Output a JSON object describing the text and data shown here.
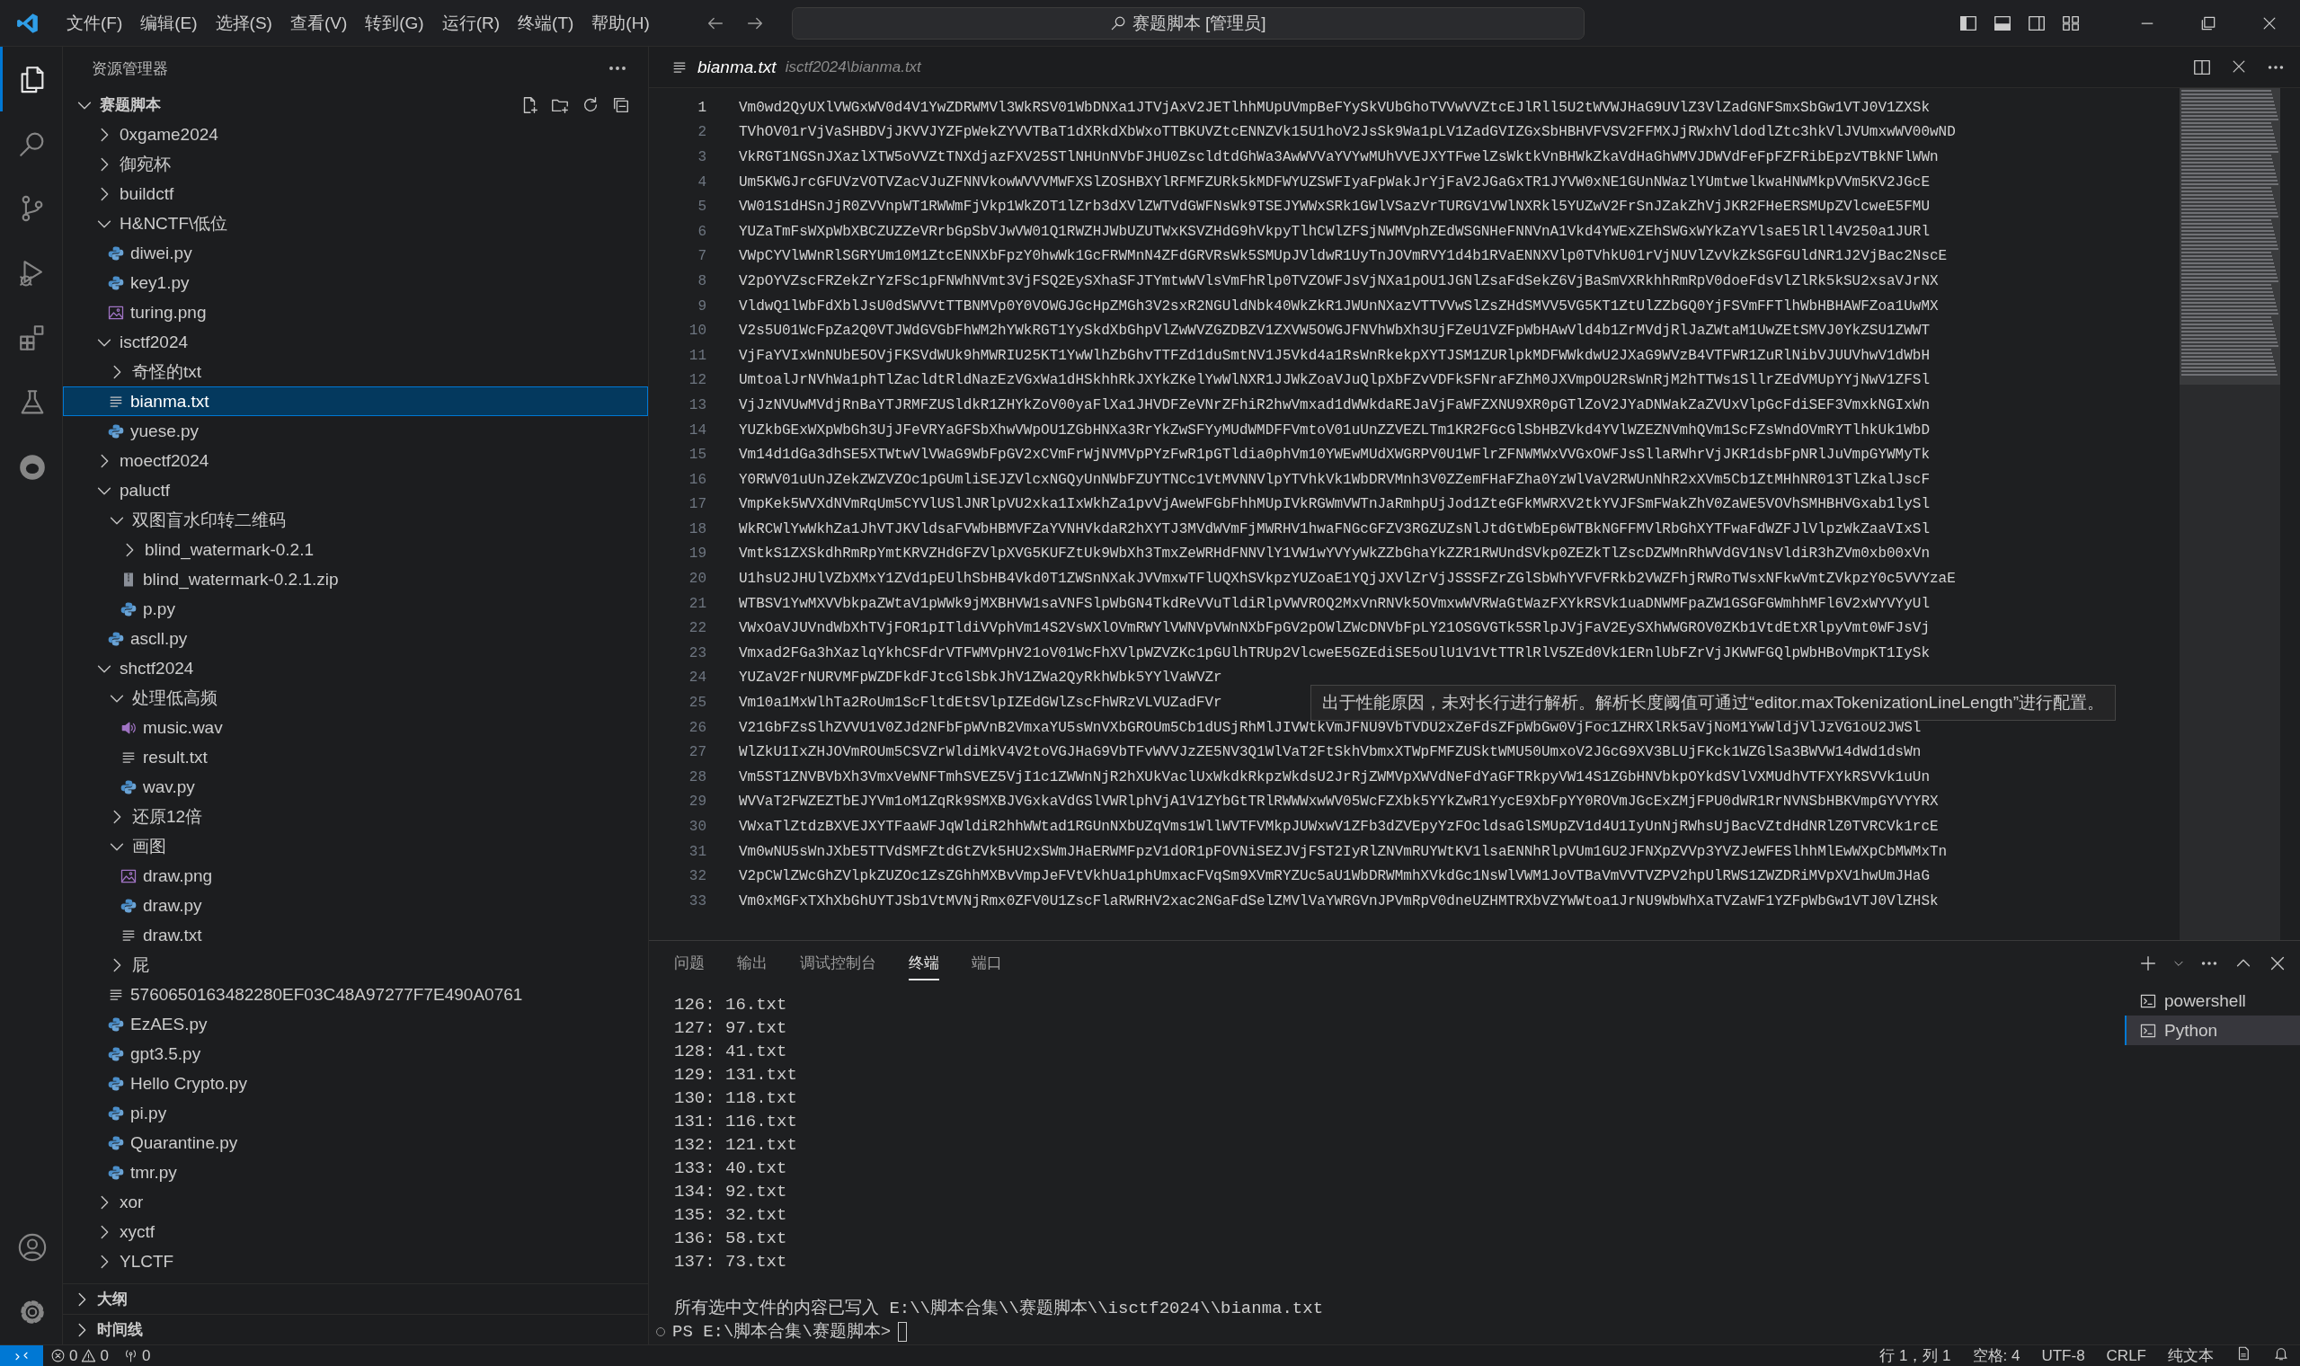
{
  "title_bar": {
    "menu": [
      "文件(F)",
      "编辑(E)",
      "选择(S)",
      "查看(V)",
      "转到(G)",
      "运行(R)",
      "终端(T)",
      "帮助(H)"
    ],
    "command_center": "赛题脚本 [管理员]"
  },
  "activity_bar": {
    "items": [
      {
        "kind": "explorer",
        "selected": true
      },
      {
        "kind": "search",
        "selected": false
      },
      {
        "kind": "source-control",
        "selected": false
      },
      {
        "kind": "run-debug",
        "selected": false
      },
      {
        "kind": "extensions",
        "selected": false
      },
      {
        "kind": "testing",
        "selected": false
      },
      {
        "kind": "extension-view",
        "selected": false
      }
    ],
    "bottom": [
      {
        "kind": "account"
      },
      {
        "kind": "settings"
      }
    ]
  },
  "sidebar": {
    "title": "资源管理器",
    "tree": {
      "label": "赛题脚本",
      "kind": "folder",
      "expanded": true,
      "selected": false,
      "children": [
        {
          "label": "0xgame2024",
          "kind": "folder",
          "expanded": false,
          "selected": false
        },
        {
          "label": "御宛杯",
          "kind": "folder",
          "expanded": false,
          "selected": false
        },
        {
          "label": "buildctf",
          "kind": "folder",
          "expanded": false,
          "selected": false
        },
        {
          "label": "H&NCTF\\低位",
          "kind": "folder",
          "expanded": true,
          "selected": false,
          "children": [
            {
              "label": "diwei.py",
              "kind": "python",
              "selected": false
            },
            {
              "label": "key1.py",
              "kind": "python",
              "selected": false
            },
            {
              "label": "turing.png",
              "kind": "image",
              "selected": false
            }
          ]
        },
        {
          "label": "isctf2024",
          "kind": "folder",
          "expanded": true,
          "selected": false,
          "children": [
            {
              "label": "奇怪的txt",
              "kind": "folder",
              "expanded": false,
              "selected": false
            },
            {
              "label": "bianma.txt",
              "kind": "text",
              "selected": true
            },
            {
              "label": "yuese.py",
              "kind": "python",
              "selected": false
            }
          ]
        },
        {
          "label": "moectf2024",
          "kind": "folder",
          "expanded": false,
          "selected": false
        },
        {
          "label": "paluctf",
          "kind": "folder",
          "expanded": true,
          "selected": false,
          "children": [
            {
              "label": "双图盲水印转二维码",
              "kind": "folder",
              "expanded": true,
              "selected": false,
              "children": [
                {
                  "label": "blind_watermark-0.2.1",
                  "kind": "folder",
                  "expanded": false,
                  "selected": false
                },
                {
                  "label": "blind_watermark-0.2.1.zip",
                  "kind": "archive",
                  "selected": false
                },
                {
                  "label": "p.py",
                  "kind": "python",
                  "selected": false
                }
              ]
            },
            {
              "label": "ascll.py",
              "kind": "python",
              "selected": false
            }
          ]
        },
        {
          "label": "shctf2024",
          "kind": "folder",
          "expanded": true,
          "selected": false,
          "children": [
            {
              "label": "处理低高频",
              "kind": "folder",
              "expanded": true,
              "selected": false,
              "children": [
                {
                  "label": "music.wav",
                  "kind": "audio",
                  "selected": false
                },
                {
                  "label": "result.txt",
                  "kind": "text",
                  "selected": false
                },
                {
                  "label": "wav.py",
                  "kind": "python",
                  "selected": false
                }
              ]
            },
            {
              "label": "还原12倍",
              "kind": "folder",
              "expanded": false,
              "selected": false
            },
            {
              "label": "画图",
              "kind": "folder",
              "expanded": true,
              "selected": false,
              "children": [
                {
                  "label": "draw.png",
                  "kind": "image",
                  "selected": false
                },
                {
                  "label": "draw.py",
                  "kind": "python",
                  "selected": false
                },
                {
                  "label": "draw.txt",
                  "kind": "text",
                  "selected": false
                }
              ]
            },
            {
              "label": "屁",
              "kind": "folder",
              "expanded": false,
              "selected": false
            },
            {
              "label": "5760650163482280EF03C48A97277F7E490A0761",
              "kind": "text",
              "selected": false
            },
            {
              "label": "EzAES.py",
              "kind": "python",
              "selected": false
            },
            {
              "label": "gpt3.5.py",
              "kind": "python",
              "selected": false
            },
            {
              "label": "Hello Crypto.py",
              "kind": "python",
              "selected": false
            },
            {
              "label": "pi.py",
              "kind": "python",
              "selected": false
            },
            {
              "label": "Quarantine.py",
              "kind": "python",
              "selected": false
            },
            {
              "label": "tmr.py",
              "kind": "python",
              "selected": false
            }
          ]
        },
        {
          "label": "xor",
          "kind": "folder",
          "expanded": false,
          "selected": false
        },
        {
          "label": "xyctf",
          "kind": "folder",
          "expanded": false,
          "selected": false
        },
        {
          "label": "YLCTF",
          "kind": "folder",
          "expanded": false,
          "selected": false
        }
      ]
    },
    "sections": [
      {
        "label": "大纲",
        "expanded": false
      },
      {
        "label": "时间线",
        "expanded": false
      }
    ]
  },
  "editor": {
    "tab": {
      "label": "bianma.txt",
      "description": "isctf2024\\bianma.txt",
      "preview": true
    },
    "lines": [
      {
        "number": "1",
        "current": true,
        "text": "Vm0wd2QyUXlVWGxWV0d4V1YwZDRWMVl3WkRSV01WbDNXa1JTVjAxV2JETlhhMUpUVmpBeFYySkVUbGhoTVVwVVZtcEJlRll5U2tWVWJHaG9UVlZ3VlZadGNFSmxSbGw1VTJ0V1ZXSk"
      },
      {
        "number": "2",
        "current": false,
        "text": "TVhOV01rVjVaSHBDVjJKVVJYZFpWekZYVVTBaT1dXRkdXbWxoTTBKUVZtcENNZVk15U1hoV2JsSk9Wa1pLV1ZadGVIZGxSbHBHVFVSV2FFMXJjRWxhVldodlZtc3hkVlJVUmxwWV00wND"
      },
      {
        "number": "3",
        "current": false,
        "text": "VkRGT1NGSnJXazlXTW5oVVZtTNXdjazFXV25STlNHUnNVbFJHU0ZscldtdGhWa3AwWVVaYVYwMUhVVEJXYTFwelZsWktkVnBHWkZkaVdHaGhWMVJDWVdFeFpFZFRibEpzVTBkNFlWWn"
      },
      {
        "number": "4",
        "current": false,
        "text": "Um5KWGJrcGFUVzVOTVZacVJuZFNNVkowWVVVMWFXSlZOSHBXYlRFMFZURk5kMDFWYUZSWFIyaFpWakJrYjFaV2JGaGxTR1JYVW0xNE1GUnNWazlYUmtwelkwaHNWMkpVVm5KV2JGcE"
      },
      {
        "number": "5",
        "current": false,
        "text": "VW01S1dHSnJjR0ZVVnpWT1RWWmFjVkp1WkZOT1lZrb3dXVlZWTVdGWFNsWk9TSEJYWWxSRk1GWlVSazVrTURGV1VWlNXRkl5YUZwV2FrSnJZakZhVjJKR2FHeERSMUpZVlcweE5FMU"
      },
      {
        "number": "6",
        "current": false,
        "text": "YUZaTmFsWXpWbXBCZUZZeVRrbGpSbVJwVW01Q1RWZHJWbUZUTWxKSVZHdG9hVkpyTlhCWlZFSjNWMVphZEdWSGNHeFNNVnA1Vkd4YWExZEhSWGxWYkZaYVlsaE5lRll4V250a1JURl"
      },
      {
        "number": "7",
        "current": false,
        "text": "VWpCYVlWWnRlSGRYUm10M1ZtcENNXbFpzY0hwWk1GcFRWMnN4ZFdGRVRsWk5SMUpJVldwR1UyTnJOVmRVY1d4b1RVaENNXVlp0TVhkU01rVjNUVlZvVkZkSGFGUldNR1J2VjBac2NscE"
      },
      {
        "number": "8",
        "current": false,
        "text": "V2pOYVZscFRZekZrYzFSc1pFNWhNVmt3VjFSQ2EySXhaSFJTYmtwWVlsVmFhRlp0TVZOWFJsVjNXa1pOU1JGNlZsaFdSekZ6VjBaSmVXRkhhRmRpV0doeFdsVlZlRk5kSU2xsaVJrNX"
      },
      {
        "number": "9",
        "current": false,
        "text": "VldwQ1lWbFdXblJsU0dSWVVtTTBNMVp0Y0VOWGJGcHpZMGh3V2sxR2NGUldNbk40WkZkR1JWUnNXazVTTVVwSlZsZHdSMVV5VG5KT1ZtUlZZbGQ0YjFSVmFFTlhWbHBHAWFZoa1UwMX"
      },
      {
        "number": "10",
        "current": false,
        "text": "V2s5U01WcFpZa2Q0VTJWdGVGbFhWM2hYWkRGT1YySkdXbGhpVlZwWVZGZDBZV1ZXVW5OWGJFNVhWbXh3UjFZeU1VZFpWbHAwVld4b1ZrMVdjRlJaZWtaM1UwZEtSMVJ0YkZSU1ZWWT"
      },
      {
        "number": "11",
        "current": false,
        "text": "VjFaYVIxWnNUbE5OVjFKSVdWUk9hMWRIU25KT1YwWlhZbGhvTTFZd1duSmtNV1J5Vkd4a1RsWnRkekpXYTJSM1ZURlpkMDFWWkdwU2JXaG9WVzB4VTFWR1ZuRlNibVJUUVhwV1dWbH"
      },
      {
        "number": "12",
        "current": false,
        "text": "UmtoalJrNVhWa1phTlZacldtRldNazEzVGxWa1dHSkhhRkJXYkZKelYwWlNXR1JJWkZoaVJuQlpXbFZvVDFkSFNraFZhM0JXVmpOU2RsWnRjM2hTTWs1SllrZEdVMUpYYjNwV1ZFSl"
      },
      {
        "number": "13",
        "current": false,
        "text": "VjJzNVUwMVdjRnBaYTJRMFZUSldkR1ZHYkZoV00yaFlXa1JHVDFZeVNrZFhiR2hwVmxad1dWWkdaREJaVjFaWFZXNU9XR0pGTlZoV2JYaDNWakZaZVUxVlpGcFdiSEF3VmxkNGIxWn"
      },
      {
        "number": "14",
        "current": false,
        "text": "YUZkbGExWXpWbGh3UjJFeVRYaGFSbXhwVWpOU1ZGbHNXa3RrYkZwSFYyMUdWMDFFVmtoV01uUnZZVEZLTm1KR2FGcGlSbHBZVkd4YVlWZEZNVmhQVm1ScFZsWndOVmRYTlhkUk1WbD"
      },
      {
        "number": "15",
        "current": false,
        "text": "Vm14d1dGa3dhSE5XTWtwVlVWaG9WbFpGV2xCVmFrWjNVMVpPYzFwR1pGTldia0phVm10YWEwMUdXWGRPV0U1WFlrZFNWMWxVVGxOWFJsSllaRWhrVjJKR1dsbFpNRlJuVmpGYWMyTk"
      },
      {
        "number": "16",
        "current": false,
        "text": "Y0RWV01uUnJZekZWZVZOc1pGUmliSEJZVlcxNGQyUnNWbFZUYTNCc1VtMVNNVlpYTVhkVk1WbDRVMnh3V0ZZemFHaFZha0YzWlVaV2RWUnNhR2xXVm5Cb1ZtMHhNR013TlZkalJscF"
      },
      {
        "number": "17",
        "current": false,
        "text": "VmpKek5WVXdNVmRqUm5CYVlUSlJNRlpVU2xka1IxWkhZa1pvVjAweWFGbFhhMUpIVkRGWmVWTnJaRmhpUjJod1ZteGFkMWRXV2tkYVJFSmFWakZhV0ZaWE5VOVhSMHBHVGxab1lySl"
      },
      {
        "number": "18",
        "current": false,
        "text": "WkRCWlYwWkhZa1JhVTJKVldsaFVWbHBMVFZaYVNHVkdaR2hXYTJ3MVdWVmFjMWRHV1hwaFNGcGFZV3RGZUZsNlJtdGtWbEp6WTBkNGFFMVlRbGhXYTFwaFdWZFJlVlpzWkZaaVIxSl"
      },
      {
        "number": "19",
        "current": false,
        "text": "VmtkS1ZXSkdhRmRpYmtKRVZHdGFZVlpXVG5KUFZtUk9WbXh3TmxZeWRHdFNNVlY1VW1wYVYyWkZZbGhaYkZZR1RWUndSVkp0ZEZkTlZscDZWMnRhWVdGV1NsVldiR3hZVm0xb00xVn"
      },
      {
        "number": "20",
        "current": false,
        "text": "U1hsU2JHUlVZbXMxY1ZVd1pEUlhSbHB4Vkd0T1ZWSnNXakJVVmxwTFlUQXhSVkpzYUZoaE1YQjJXVlZrVjJSSSFZrZGlSbWhYVFVFRkb2VWZFhjRWRoTWsxNFkwVmtZVkpzY0c5VVYzaE"
      },
      {
        "number": "21",
        "current": false,
        "text": "WTBSV1YwMXVVbkpaZWtaV1pWWk9jMXBHVW1saVNFSlpWbGN4TkdReVVuTldiRlpVWVROQ2MxVnRNVk5OVmxwWVRWaGtWazFXYkRSVk1uaDNWMFpaZW1GSGFGWmhhMFl6V2xWYVYyUl"
      },
      {
        "number": "22",
        "current": false,
        "text": "VWxOaVJUVndWbXhTVjFOR1pITldiVVphVm14S2VsWXlOVmRWYlVWNVpVWnNXbFpGV2pOWlZWcDNVbFpLY21OSGVGTk5SRlpJVjFaV2EySXhWWGROV0ZKb1VtdEtXRlpyVmt0WFJsVj"
      },
      {
        "number": "23",
        "current": false,
        "text": "Vmxad2FGa3hXazlqYkhCSFdrVTFWMVpHV21oV01WcFhXVlpWZVZKc1pGUlhTRUp2VlcweE5GZEdiSE5oUlU1V1VtTTRlRlV5ZEd0Vk1ERnlUbFZrVjJKWWFGQlpWbHBoVmpKT1IySk"
      },
      {
        "number": "24",
        "current": false,
        "text": "YUZaV2FrNURVMFpWZDFkdFJtcGlSbkJhV1ZWa2QyRkhWbk5YYlVaWVZr"
      },
      {
        "number": "25",
        "current": false,
        "text": "Vm10a1MxWlhTa2RoUm1ScFltdEtSVlpIZEdGWlZscFhWRzVLVUZadFVr"
      },
      {
        "number": "26",
        "current": false,
        "text": "V21GbFZsSlhZVVU1V0ZJd2NFbFpWVnB2VmxaYU5sWnVXbGROUm5Cb1dUSjRhMlJIVWtkVmJFNU9VbTVDU2xZeFdsZFpWbGw0VjFoc1ZHRXlRk5aVjNoM1YwWldjVlJzVG1oU2JWSl"
      },
      {
        "number": "27",
        "current": false,
        "text": "WlZkU1IxZHJOVmROUm5CSVZrWldiMkV4V2toVGJHaG9VbTFvWVVJzZE5NV3Q1WlVaT2FtSkhVbmxXTWpFMFZUSktWMU50UmxoV2JGcG9XV3BLUjFKck1WZGlSa3BWVW14dWd1dsWn"
      },
      {
        "number": "28",
        "current": false,
        "text": "Vm5ST1ZNVBVbXh3VmxVeWNFTmhSVEZ5VjI1c1ZWWnNjR2hXUkVaclUxWkdkRkpzWkdsU2JrRjZWMVpXWVdNeFdYaGFTRkpyVW14S1ZGbHNVbkpOYkdSVlVXMUdhVTFXYkRSVVk1uUn"
      },
      {
        "number": "29",
        "current": false,
        "text": "WVVaT2FWZEZTbEJYVm1oM1ZqRk9SMXBJVGxkaVdGSlVWRlphVjA1V1ZYbGtTRlRWWWxwWV05WcFZXbk5YYkZwR1YycE9XbFpYY0ROVmJGcExZMjFPU0dWR1RrNVNSbHBKVmpGYVYYRX"
      },
      {
        "number": "30",
        "current": false,
        "text": "VWxaTlZtdzBXVEJXYTFaaWFJqWldiR2hhWWtad1RGUnNXbUZqVms1WllWVTFVMkpJUWxwV1ZFb3dZVEpyYzFOcldsaGlSMUpZV1d4U1IyUnNjRWhsUjBacVZtdHdNRlZ0TVRCVk1rcE"
      },
      {
        "number": "31",
        "current": false,
        "text": "Vm0wNU5sWnJXbE5TTVdSMFZtdGtZVk5HU2xSWmJHaERWMFpzV1dOR1pFOVNiSEZJVjFST2IyRlZNVmRUYWtKV1lsaENNhRlpVUm1GU2JFNXpZVVp3YVZJeWFESlhhMlEwWXpCbMWMxTn"
      },
      {
        "number": "32",
        "current": false,
        "text": "V2pCWlZWcGhZVlpkZUZOc1ZsZGhhMXBvVmpJeFVtVkhUa1phUmxacFVqSm9XVmRYZUc5aU1WbDRWMmhXVkdGc1NsWlVWM1JoVTBaVmVVTVZPV2hpUlRWS1ZWZDRiMVpXV1hwUmJHaG"
      },
      {
        "number": "33",
        "current": false,
        "text": "Vm0xMGFxTXhXbGhUYTJSb1VtMVNjRmx0ZFV0U1ZscFlaRWRHV2xac2NGaFdSelZMVlVaYWRGVnJPVmRpV0dneUZHMTRXbVZYWWtoa1JrNU9WbWhXaTVZaWF1YZFpWbGw1VTJ0VlZHSk"
      }
    ],
    "tooltip": "出于性能原因，未对长行进行解析。解析长度阈值可通过“editor.maxTokenizationLineLength”进行配置。"
  },
  "panel": {
    "tabs": [
      {
        "label": "问题",
        "selected": false
      },
      {
        "label": "输出",
        "selected": false
      },
      {
        "label": "调试控制台",
        "selected": false
      },
      {
        "label": "终端",
        "selected": true
      },
      {
        "label": "端口",
        "selected": false
      }
    ],
    "terminal_lines": [
      "126: 16.txt",
      "127: 97.txt",
      "128: 41.txt",
      "129: 131.txt",
      "130: 118.txt",
      "131: 116.txt",
      "132: 121.txt",
      "133: 40.txt",
      "134: 92.txt",
      "135: 32.txt",
      "136: 58.txt",
      "137: 73.txt"
    ],
    "message": "所有选中文件的内容已写入 E:\\\\脚本合集\\\\赛题脚本\\\\isctf2024\\\\bianma.txt",
    "prompt": "PS E:\\脚本合集\\赛题脚本>",
    "terminals": [
      {
        "label": "powershell",
        "selected": false
      },
      {
        "label": "Python",
        "selected": true
      }
    ]
  },
  "status_bar": {
    "errors": "0",
    "warnings": "0",
    "ports": "0",
    "position": "行 1，列 1",
    "indent": "空格: 4",
    "encoding": "UTF-8",
    "eol": "CRLF",
    "language": "纯文本"
  }
}
